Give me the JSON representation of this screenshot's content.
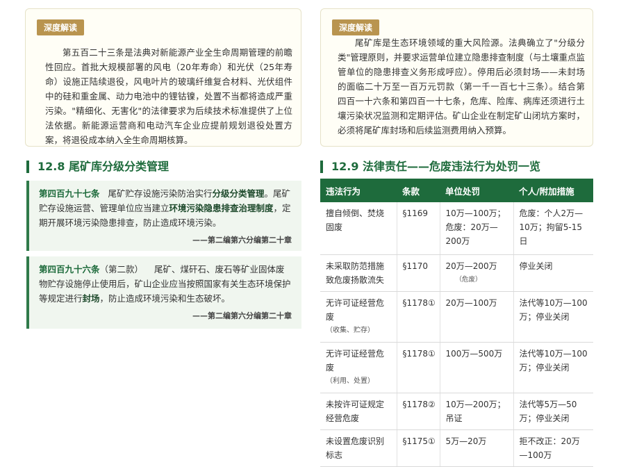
{
  "left_card": {
    "tag": "深度解读",
    "body": "第五百二十三条是法典对新能源产业全生命周期管理的前瞻性回应。首批大规模部署的风电（20年寿命）和光伏（25年寿命）设施正陆续退役，风电叶片的玻璃纤维复合材料、光伏组件中的硅和重金属、动力电池中的锂钴镍，处置不当都将造成严重污染。\"精细化、无害化\"的法律要求为后续技术标准提供了上位法依据。新能源运营商和电动汽车企业应提前规划退役处置方案，将退役成本纳入全生命周期核算。"
  },
  "right_card": {
    "tag": "深度解读",
    "body": "尾矿库是生态环境领域的重大风险源。法典确立了\"分级分类\"管理原则，并要求运营单位建立隐患排查制度（与土壤重点监管单位的隐患排查义务形成呼应）。停用后必须封场——未封场的面临二十万至一百万元罚款（第一千一百七十三条）。结合第四百一十六条和第四百一十七条，危库、险库、病库还须进行土壤污染状况监测和定期评估。矿山企业在制定矿山闭坑方案时，必须将尾矿库封场和后续监测费用纳入预算。"
  },
  "section_left": {
    "title": "12.8 尾矿库分级分类管理"
  },
  "section_right": {
    "title": "12.9 法律责任——危废违法行为处罚一览"
  },
  "clause1": {
    "article": "第四百九十七条",
    "t1": "尾矿贮存设施污染防治实行",
    "k1": "分级分类管理",
    "t2": "。尾矿贮存设施运营、管理单位应当建立",
    "k2": "环境污染隐患排查治理制度",
    "t3": "，定期开展环境污染隐患排查，防止造成环境污染。",
    "source": "——第二编第六分编第二十章"
  },
  "clause2": {
    "article": "第四百九十六条",
    "note": "（第二款）",
    "t1": "尾矿、煤矸石、废石等矿业固体废物贮存设施停止使用后，矿山企业应当按照国家有关生态环境保护等规定进行",
    "k1": "封场",
    "t2": "，防止造成环境污染和生态破坏。",
    "source": "——第二编第六分编第二十章"
  },
  "table": {
    "headers": [
      "违法行为",
      "条款",
      "单位处罚",
      "个人/附加措施"
    ],
    "rows": [
      {
        "act": "擅自倾倒、焚烧固废",
        "act_note": "",
        "clause": "§1169",
        "unit": "10万—100万；危废：20万—200万",
        "unit_note": "",
        "person": "危废：个人2万—10万；拘留5-15日"
      },
      {
        "act": "未采取防范措施致危废扬散流失",
        "act_note": "",
        "clause": "§1170",
        "unit": "20万—200万",
        "unit_note": "（危废）",
        "person": "停业关闭"
      },
      {
        "act": "无许可证经营危废",
        "act_note": "（收集、贮存）",
        "clause": "§1178①",
        "unit": "20万—100万",
        "unit_note": "",
        "person": "法代等10万—100万；停业关闭"
      },
      {
        "act": "无许可证经营危废",
        "act_note": "（利用、处置）",
        "clause": "§1178①",
        "unit": "100万—500万",
        "unit_note": "",
        "person": "法代等10万—100万；停业关闭"
      },
      {
        "act": "未按许可证规定经营危废",
        "act_note": "",
        "clause": "§1178②",
        "unit": "10万—200万；吊证",
        "unit_note": "",
        "person": "法代等5万—50万；停业关闭"
      },
      {
        "act": "未设置危废识别标志",
        "act_note": "",
        "clause": "§1175①",
        "unit": "5万—20万",
        "unit_note": "",
        "person": "拒不改正：20万—100万"
      }
    ]
  }
}
